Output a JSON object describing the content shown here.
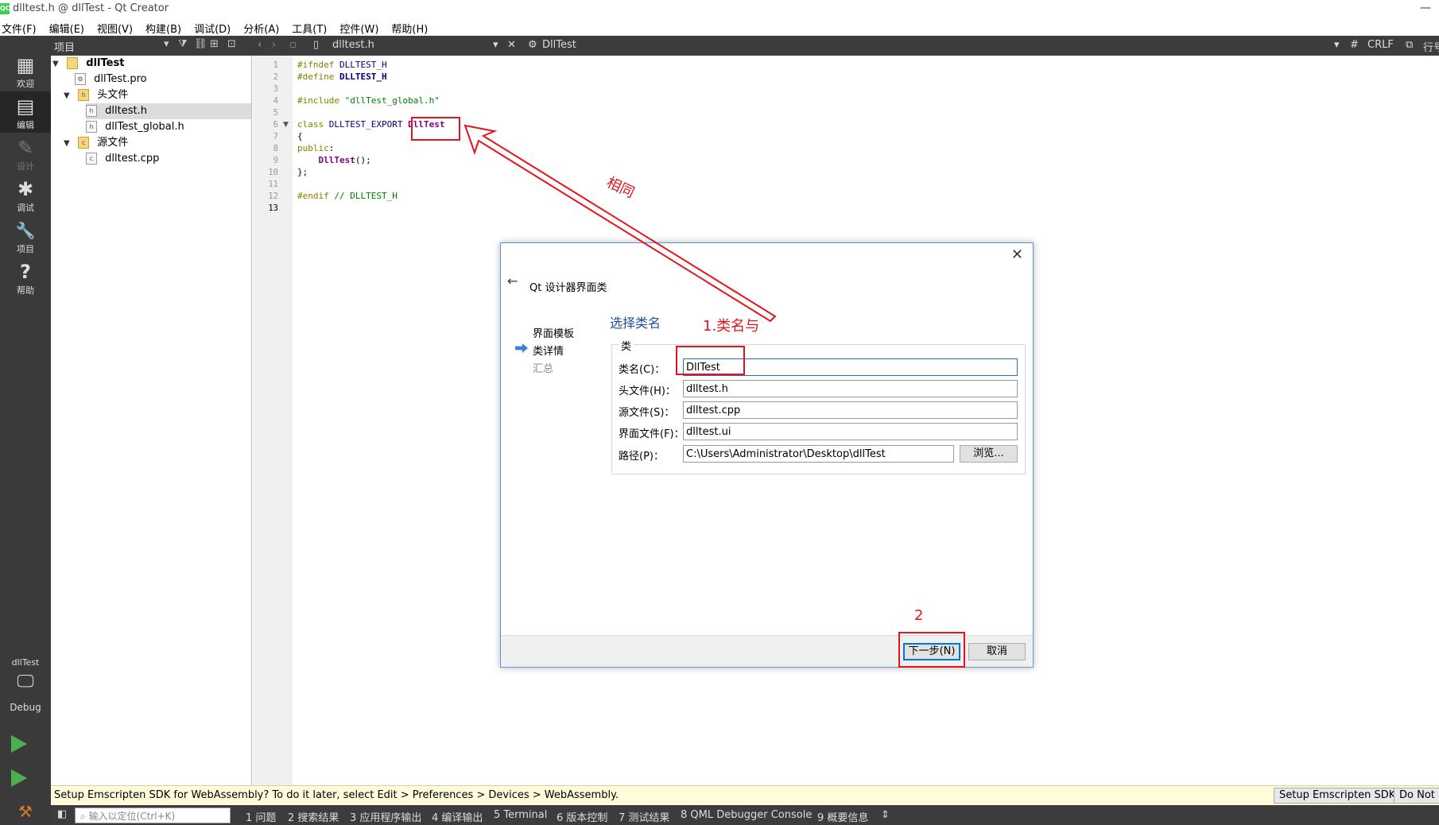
{
  "window": {
    "title": "dlltest.h @ dllTest - Qt Creator",
    "app_icon": "QC"
  },
  "menubar": [
    "文件(F)",
    "编辑(E)",
    "视图(V)",
    "构建(B)",
    "调试(D)",
    "分析(A)",
    "工具(T)",
    "控件(W)",
    "帮助(H)"
  ],
  "modes": [
    {
      "label": "欢迎",
      "icon": "grid-icon",
      "glyph": "▦"
    },
    {
      "label": "编辑",
      "icon": "edit-document-icon",
      "glyph": "▤"
    },
    {
      "label": "设计",
      "icon": "pencil-icon",
      "glyph": "✎"
    },
    {
      "label": "调试",
      "icon": "bug-icon",
      "glyph": "✱"
    },
    {
      "label": "项目",
      "icon": "wrench-icon",
      "glyph": "🔧"
    },
    {
      "label": "帮助",
      "icon": "help-icon",
      "glyph": "?"
    }
  ],
  "kit": {
    "project": "dllTest",
    "config": "Debug"
  },
  "project_panel": {
    "label": "项目"
  },
  "tree": {
    "root": "dllTest",
    "pro_file": "dllTest.pro",
    "headers_folder": "头文件",
    "header1": "dlltest.h",
    "header2": "dllTest_global.h",
    "sources_folder": "源文件",
    "source1": "dlltest.cpp"
  },
  "editor_bar": {
    "file": "dlltest.h",
    "class": "DllTest",
    "hash": "#",
    "line_ending": "CRLF",
    "trailing": "行号"
  },
  "code": {
    "line_numbers": [
      "1",
      "2",
      "3",
      "4",
      "5",
      "6",
      "7",
      "8",
      "9",
      "10",
      "11",
      "12",
      "13"
    ],
    "l1_kw": "#ifndef",
    "l1_mac": " DLLTEST_H",
    "l2_kw": "#define",
    "l2_mac": " DLLTEST_H",
    "l4_kw": "#include",
    "l4_str": " \"dllTest_global.h\"",
    "l6_kw": "class",
    "l6_mac": " DLLTEST_EXPORT ",
    "l6_cls": "DllTest",
    "l7": "{",
    "l8_kw": "public",
    "l8_rest": ":",
    "l9_fn": "    DllTest",
    "l9_rest": "();",
    "l10": "};",
    "l12_kw": "#endif",
    "l12_cmt": " // DLLTEST_H"
  },
  "dialog": {
    "title": "Qt 设计器界面类",
    "steps": [
      "界面模板",
      "类详情",
      "汇总"
    ],
    "heading": "选择类名",
    "group_label": "类",
    "fields": [
      {
        "label": "类名(C)：",
        "value": "DllTest"
      },
      {
        "label": "头文件(H)：",
        "value": "dlltest.h"
      },
      {
        "label": "源文件(S)：",
        "value": "dlltest.cpp"
      },
      {
        "label": "界面文件(F)：",
        "value": "dlltest.ui"
      },
      {
        "label": "路径(P)：",
        "value": "C:\\Users\\Administrator\\Desktop\\dllTest"
      }
    ],
    "browse": "浏览...",
    "next": "下一步(N)",
    "cancel": "取消"
  },
  "annotations": {
    "same": "相同",
    "step1": "1.类名与",
    "step2": "2",
    "color": "#e3141b"
  },
  "infobar": {
    "message": "Setup Emscripten SDK for WebAssembly? To do it later, select Edit > Preferences > Devices > WebAssembly.",
    "btn_setup": "Setup Emscripten SDK",
    "btn_dont": "Do Not Show Again"
  },
  "outbar": {
    "search_placeholder": "输入以定位(Ctrl+K)",
    "tabs": [
      "1 问题",
      "2 搜索结果",
      "3 应用程序输出",
      "4 编译输出",
      "5 Terminal",
      "6 版本控制",
      "7 测试结果",
      "8 QML Debugger Console",
      "9 概要信息"
    ]
  }
}
